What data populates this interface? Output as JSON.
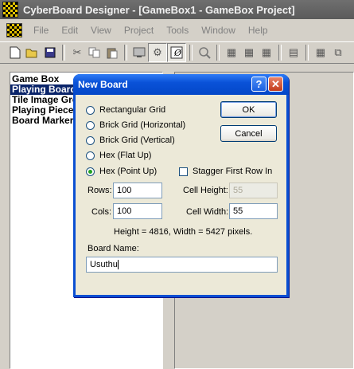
{
  "window": {
    "title": "CyberBoard Designer - [GameBox1 - GameBox Project]"
  },
  "menu": {
    "items": [
      "File",
      "Edit",
      "View",
      "Project",
      "Tools",
      "Window",
      "Help"
    ]
  },
  "toolbar": {
    "icons": [
      "new-icon",
      "open-icon",
      "save-icon",
      "cut-icon",
      "copy-icon",
      "paste-icon",
      "display-icon",
      "cog-icon",
      "text-tool-icon",
      "zoom-icon",
      "grid-icon-1",
      "grid-icon-2",
      "grid-icon-3",
      "table-icon",
      "grid-small-icon",
      "arrange-icon"
    ]
  },
  "project_tree": {
    "items": [
      {
        "label": "Game Box",
        "selected": false
      },
      {
        "label": "Playing Boards",
        "selected": true
      },
      {
        "label": "Tile Image Groups",
        "selected": false
      },
      {
        "label": "Playing Pieces",
        "selected": false
      },
      {
        "label": "Board Markers",
        "selected": false
      }
    ]
  },
  "dialog": {
    "title": "New Board",
    "help_label": "?",
    "close_label": "✕",
    "grid_options": [
      {
        "label": "Rectangular Grid",
        "checked": false
      },
      {
        "label": "Brick Grid (Horizontal)",
        "checked": false
      },
      {
        "label": "Brick Grid (Vertical)",
        "checked": false
      },
      {
        "label": "Hex (Flat Up)",
        "checked": false
      },
      {
        "label": "Hex (Point Up)",
        "checked": true
      }
    ],
    "stagger": {
      "label": "Stagger First Row In",
      "checked": false
    },
    "ok_label": "OK",
    "cancel_label": "Cancel",
    "rows": {
      "label": "Rows:",
      "value": "100"
    },
    "cols": {
      "label": "Cols:",
      "value": "100"
    },
    "cell_height": {
      "label": "Cell Height:",
      "value": "55",
      "disabled": true
    },
    "cell_width": {
      "label": "Cell Width:",
      "value": "55"
    },
    "size_info": "Height = 4816, Width = 5427 pixels.",
    "board_name": {
      "label": "Board Name:",
      "value": "Usuthu"
    }
  }
}
